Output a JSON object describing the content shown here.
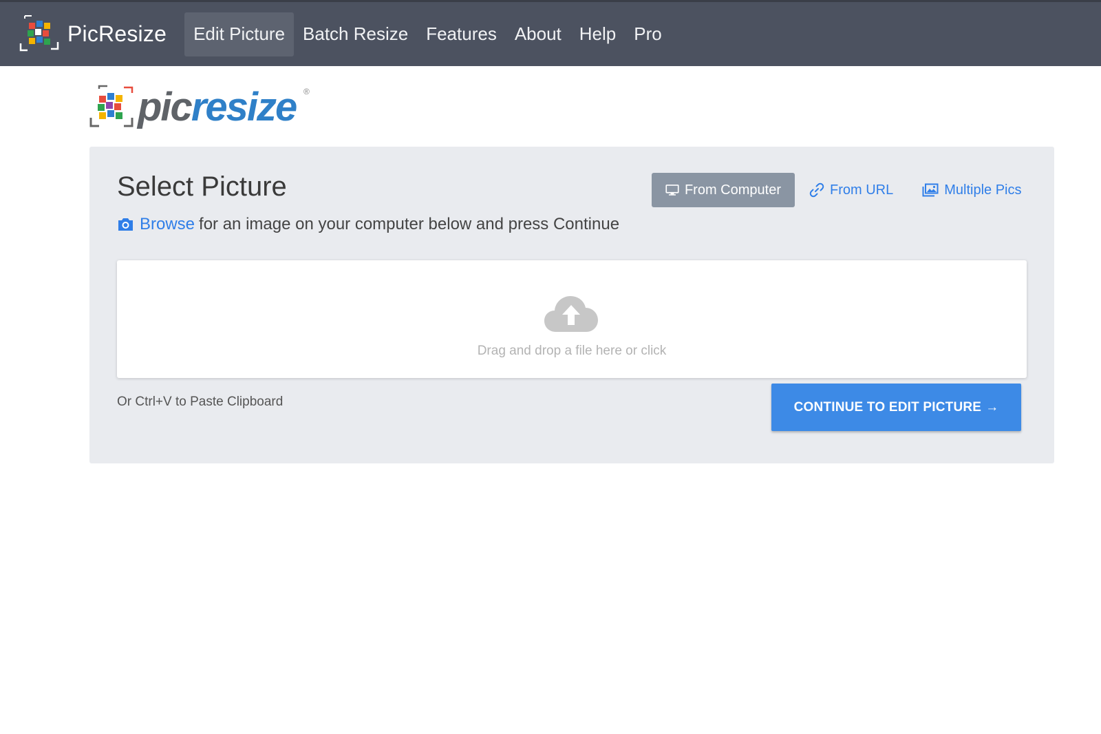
{
  "navbar": {
    "brand": "PicResize",
    "items": [
      {
        "label": "Edit Picture",
        "active": true
      },
      {
        "label": "Batch Resize"
      },
      {
        "label": "Features"
      },
      {
        "label": "About"
      },
      {
        "label": "Help"
      },
      {
        "label": "Pro"
      }
    ]
  },
  "logo": {
    "part1": "pic",
    "part2": "resize",
    "reg": "®"
  },
  "panel": {
    "title": "Select Picture",
    "tabs": [
      {
        "label": "From Computer",
        "icon": "monitor-icon",
        "active": true
      },
      {
        "label": "From URL",
        "icon": "link-icon"
      },
      {
        "label": "Multiple Pics",
        "icon": "images-icon"
      }
    ],
    "hint": {
      "link": "Browse",
      "text": "for an image on your computer below and press Continue"
    },
    "dropzone": {
      "text": "Drag and drop a file here or click",
      "icon": "cloud-upload-icon"
    },
    "paste_note": "Or Ctrl+V to Paste Clipboard",
    "continue_label": "CONTINUE TO EDIT PICTURE",
    "continue_arrow": "→"
  },
  "colors": {
    "navbar_bg": "#4c5260",
    "panel_bg": "#e9ebef",
    "accent": "#3d8ae6",
    "link": "#2f7ee8",
    "active_tab": "#8a95a3"
  }
}
